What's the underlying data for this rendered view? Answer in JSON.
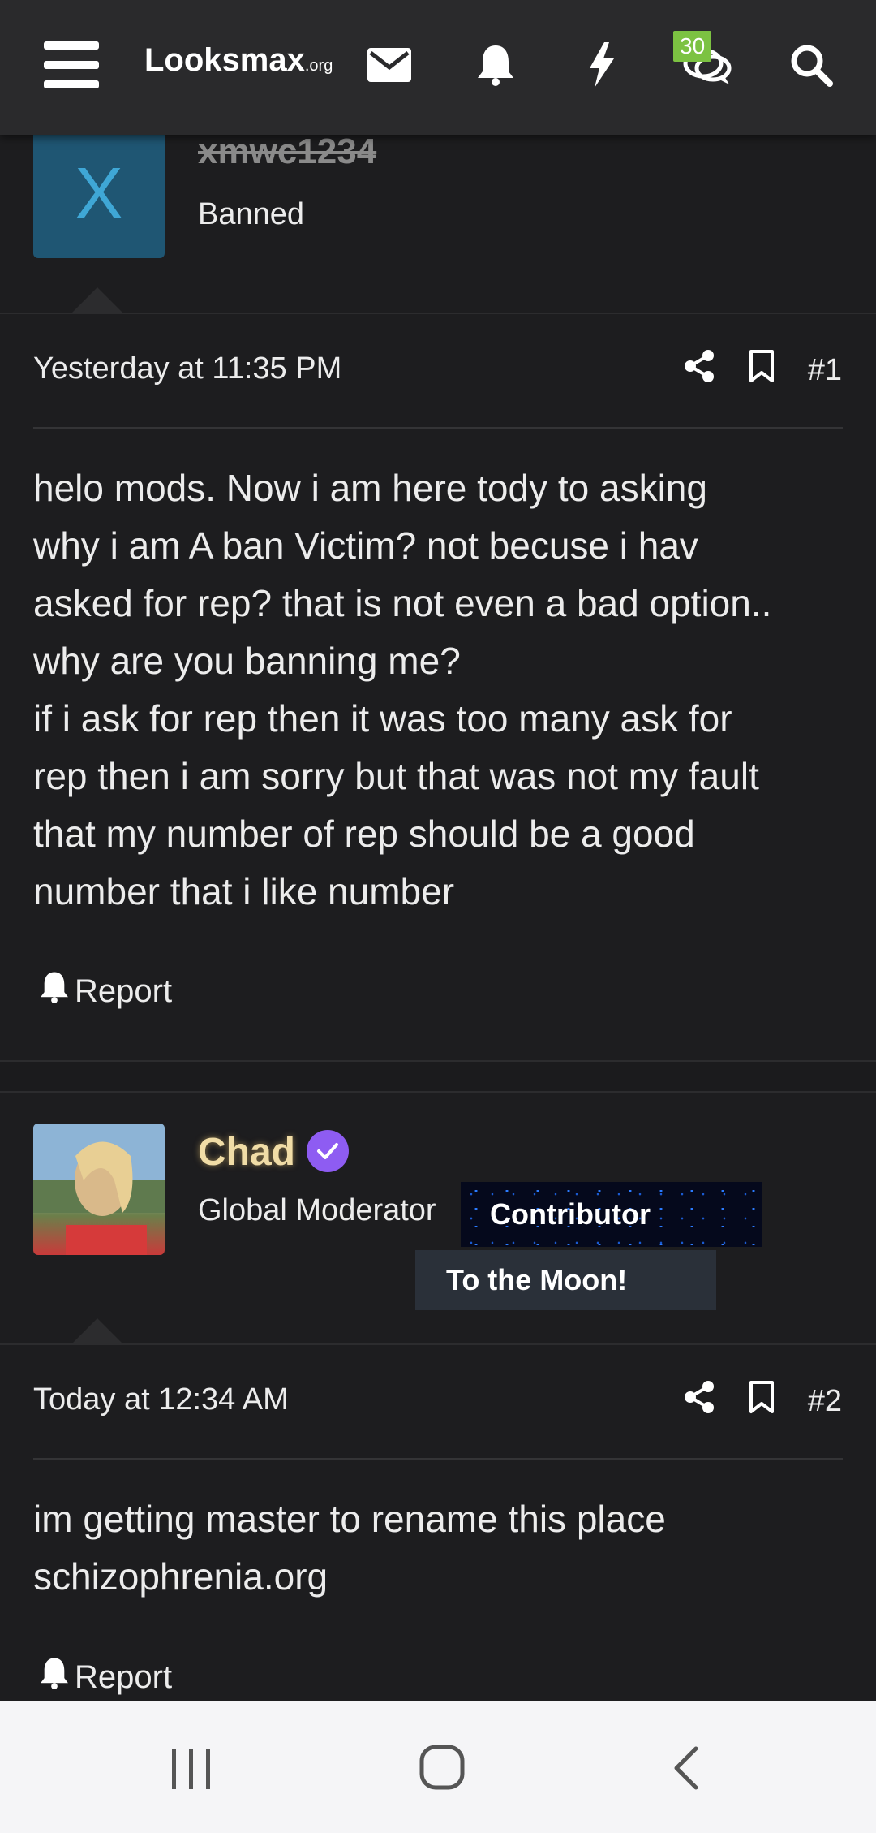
{
  "header": {
    "logo_text": "Looksmax",
    "logo_suffix": ".org",
    "conversations_badge": "30"
  },
  "posts": [
    {
      "username": "xmwc1234",
      "avatar_letter": "X",
      "user_title": "Banned",
      "timestamp": "Yesterday at 11:35 PM",
      "post_number": "#1",
      "body": [
        "helo mods. Now i am here tody to asking",
        "why i am A ban Victim? not becuse i hav",
        "asked for rep? that is not even a bad option..",
        "why are you banning me?",
        "if i ask for rep then it was too many ask for",
        "rep then i am sorry but that was not my fault",
        "that my number of rep should be a good",
        "number that i like number"
      ],
      "report_label": "Report"
    },
    {
      "username": "Chad",
      "user_title": "Global Moderator",
      "banners": [
        "Contributor",
        "To the Moon!"
      ],
      "timestamp": "Today at 12:34 AM",
      "post_number": "#2",
      "body": [
        "im getting master to rename this place",
        "schizophrenia.org"
      ],
      "report_label": "Report"
    }
  ],
  "colors": {
    "background": "#1d1d1f",
    "topbar": "#2a2a2c",
    "badge": "#7cc242",
    "verified": "#8e5cf2",
    "banned_avatar": "#1f5673"
  }
}
